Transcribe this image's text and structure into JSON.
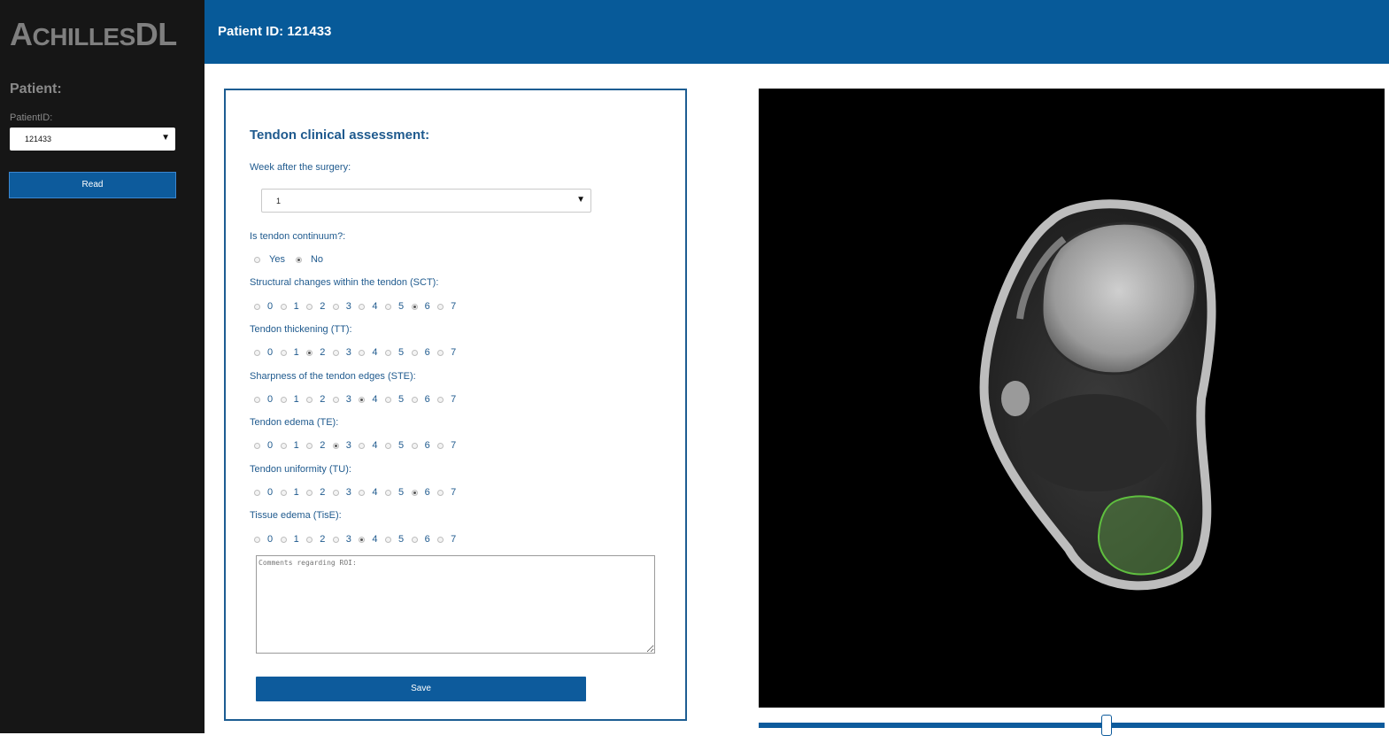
{
  "app": {
    "logo_big_a": "A",
    "logo_small_chilles": "CHILLES",
    "logo_dl": "DL"
  },
  "sidebar": {
    "heading": "Patient:",
    "patient_id_label": "PatientID:",
    "patient_id_value": "121433",
    "read_button": "Read"
  },
  "header": {
    "title": "Patient ID: 121433"
  },
  "form": {
    "title": "Tendon clinical assessment:",
    "week_label": "Week after the surgery:",
    "week_value": "1",
    "continuum_label": "Is tendon continuum?:",
    "continuum_options": [
      "Yes",
      "No"
    ],
    "continuum_selected": "No",
    "scales": [
      {
        "label": "Structural changes within the tendon (SCT):",
        "selected": 6
      },
      {
        "label": "Tendon thickening (TT):",
        "selected": 2
      },
      {
        "label": "Sharpness of the tendon edges (STE):",
        "selected": 4
      },
      {
        "label": "Tendon edema (TE):",
        "selected": 3
      },
      {
        "label": "Tendon uniformity (TU):",
        "selected": 6
      },
      {
        "label": "Tissue edema (TisE):",
        "selected": 4
      }
    ],
    "scale_values": [
      "0",
      "1",
      "2",
      "3",
      "4",
      "5",
      "6",
      "7"
    ],
    "comments_placeholder": "Comments regarding ROI:",
    "save_button": "Save"
  },
  "viewer": {
    "slice_slider_position": 0.556,
    "roi_color": "#5fbf3f"
  },
  "colors": {
    "primary": "#0d5b9c",
    "header": "#075a99",
    "sidebar": "#161616",
    "label_text": "#1f5a8e"
  }
}
